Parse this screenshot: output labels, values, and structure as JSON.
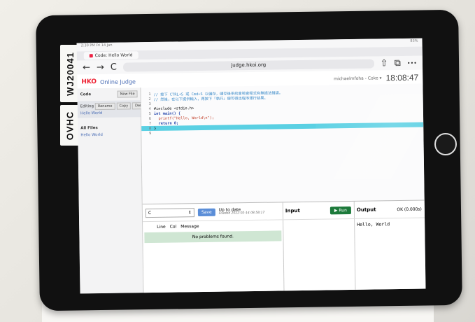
{
  "device": {
    "stickers": [
      "WJ20041",
      "OVHC"
    ]
  },
  "browser": {
    "status_left": "2:30 PM  Fri 14 Jan",
    "status_right": "83%",
    "tab_title": "Code: Hello World",
    "url": "judge.hkoi.org",
    "nav": {
      "back": "←",
      "forward": "→",
      "reload": "C",
      "share": "⇧",
      "tabs": "⧉",
      "more": "•••"
    }
  },
  "app": {
    "logo": "HKO",
    "title": "Online Judge",
    "user": "michaelmfoha - Coke ▾",
    "clock": "18:08:47"
  },
  "sidebar": {
    "code_label": "Code",
    "new_file": "New File",
    "editing_label": "Editing",
    "rename": "Rename",
    "copy": "Copy",
    "delete": "Delete",
    "current_file": "Hello World",
    "all_files": "All Files",
    "file_item": "Hello World"
  },
  "editor": {
    "lines": [
      {
        "n": "1",
        "t": "// 按下 CTRL+S 或 Cmd+S 以儲存，儲存後系統會檢查程式有無語法錯誤。",
        "c": "cmt"
      },
      {
        "n": "2",
        "t": "// 然後，在以下提供輸入，再按下「執行」便可得出程序運行結果。",
        "c": "cmt"
      },
      {
        "n": "3",
        "t": "",
        "c": ""
      },
      {
        "n": "4",
        "t": "#include <stdio.h>",
        "c": ""
      },
      {
        "n": "5",
        "t": "int main() {",
        "c": "kw"
      },
      {
        "n": "6",
        "t": "  printf(\"Hello, World\\n\");",
        "c": "str"
      },
      {
        "n": "7",
        "t": "  return 0;",
        "c": "kw"
      },
      {
        "n": "8",
        "t": "}",
        "c": "hl"
      },
      {
        "n": "9",
        "t": "",
        "c": ""
      }
    ]
  },
  "compile": {
    "language": "C",
    "save": "Save",
    "status": "Up to date",
    "loaded": "Loaded 2022-02-14 08:58:17",
    "col_line": "Line",
    "col_col": "Col",
    "col_msg": "Message",
    "no_problems": "No problems found."
  },
  "input": {
    "title": "Input",
    "run": "Run"
  },
  "output": {
    "title": "Output",
    "status": "OK (0.000s)",
    "text": "Hello, World"
  }
}
